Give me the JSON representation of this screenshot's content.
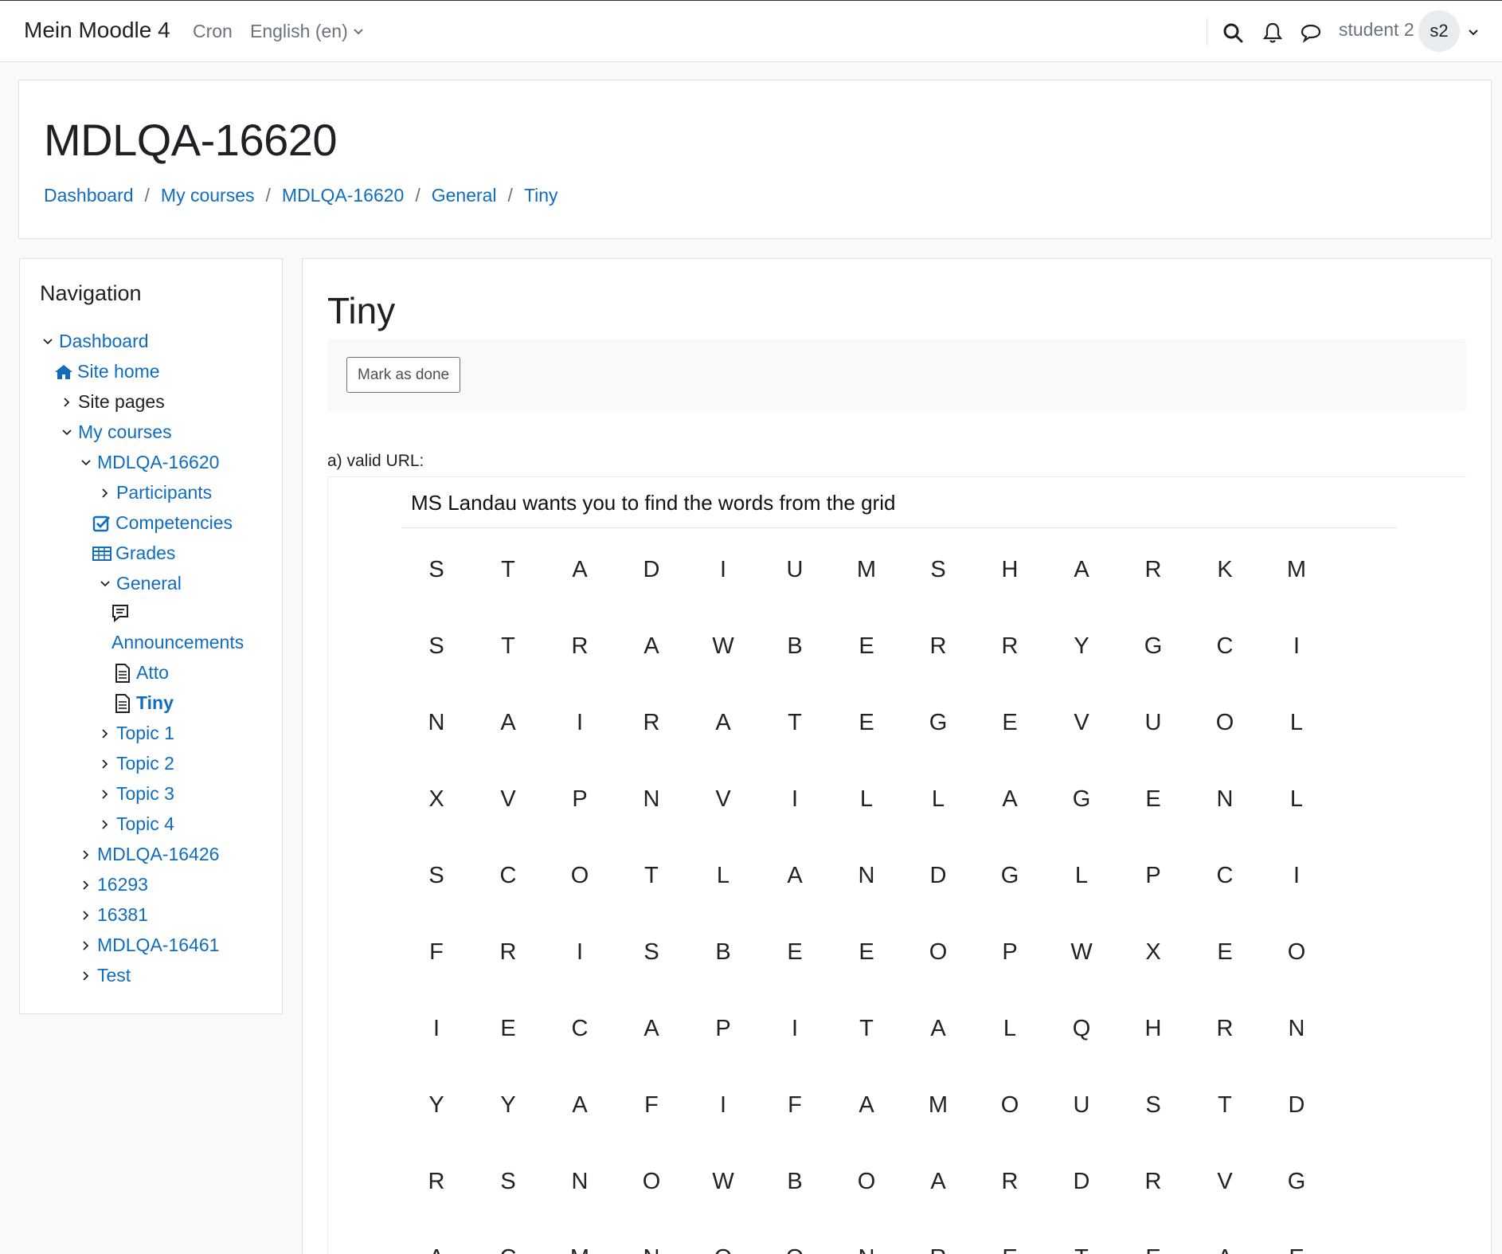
{
  "navbar": {
    "brand": "Mein Moodle 4",
    "cron": "Cron",
    "language": "English (en)",
    "user_name": "student 2",
    "avatar_initials": "s2",
    "icons": [
      "search-icon",
      "bell-icon",
      "chat-icon"
    ]
  },
  "header": {
    "title": "MDLQA-16620",
    "breadcrumb": [
      "Dashboard",
      "My courses",
      "MDLQA-16620",
      "General",
      "Tiny"
    ]
  },
  "navigation": {
    "title": "Navigation",
    "items": [
      {
        "label": "Dashboard"
      },
      {
        "label": "Site home"
      },
      {
        "label": "Site pages"
      },
      {
        "label": "My courses"
      },
      {
        "label": "MDLQA-16620"
      },
      {
        "label": "Participants"
      },
      {
        "label": "Competencies"
      },
      {
        "label": "Grades"
      },
      {
        "label": "General"
      },
      {
        "label": "Announcements"
      },
      {
        "label": "Atto"
      },
      {
        "label": "Tiny"
      },
      {
        "label": "Topic 1"
      },
      {
        "label": "Topic 2"
      },
      {
        "label": "Topic 3"
      },
      {
        "label": "Topic 4"
      },
      {
        "label": "MDLQA-16426"
      },
      {
        "label": "16293"
      },
      {
        "label": "16381"
      },
      {
        "label": "MDLQA-16461"
      },
      {
        "label": "Test"
      }
    ]
  },
  "main": {
    "title": "Tiny",
    "mark_done": "Mark as done",
    "intro_label": "a) valid URL:",
    "puzzle": {
      "title": "MS Landau wants you to find the words from the grid",
      "rows": [
        [
          "S",
          "T",
          "A",
          "D",
          "I",
          "U",
          "M",
          "S",
          "H",
          "A",
          "R",
          "K",
          "M"
        ],
        [
          "S",
          "T",
          "R",
          "A",
          "W",
          "B",
          "E",
          "R",
          "R",
          "Y",
          "G",
          "C",
          "I"
        ],
        [
          "N",
          "A",
          "I",
          "R",
          "A",
          "T",
          "E",
          "G",
          "E",
          "V",
          "U",
          "O",
          "L"
        ],
        [
          "X",
          "V",
          "P",
          "N",
          "V",
          "I",
          "L",
          "L",
          "A",
          "G",
          "E",
          "N",
          "L"
        ],
        [
          "S",
          "C",
          "O",
          "T",
          "L",
          "A",
          "N",
          "D",
          "G",
          "L",
          "P",
          "C",
          "I"
        ],
        [
          "F",
          "R",
          "I",
          "S",
          "B",
          "E",
          "E",
          "O",
          "P",
          "W",
          "X",
          "E",
          "O"
        ],
        [
          "I",
          "E",
          "C",
          "A",
          "P",
          "I",
          "T",
          "A",
          "L",
          "Q",
          "H",
          "R",
          "N"
        ],
        [
          "Y",
          "Y",
          "A",
          "F",
          "I",
          "F",
          "A",
          "M",
          "O",
          "U",
          "S",
          "T",
          "D"
        ],
        [
          "R",
          "S",
          "N",
          "O",
          "W",
          "B",
          "O",
          "A",
          "R",
          "D",
          "R",
          "V",
          "G"
        ],
        [
          "A",
          "C",
          "M",
          "N",
          "O",
          "O",
          "N",
          "R",
          "E",
          "T",
          "E",
          "A",
          "E"
        ]
      ]
    }
  }
}
